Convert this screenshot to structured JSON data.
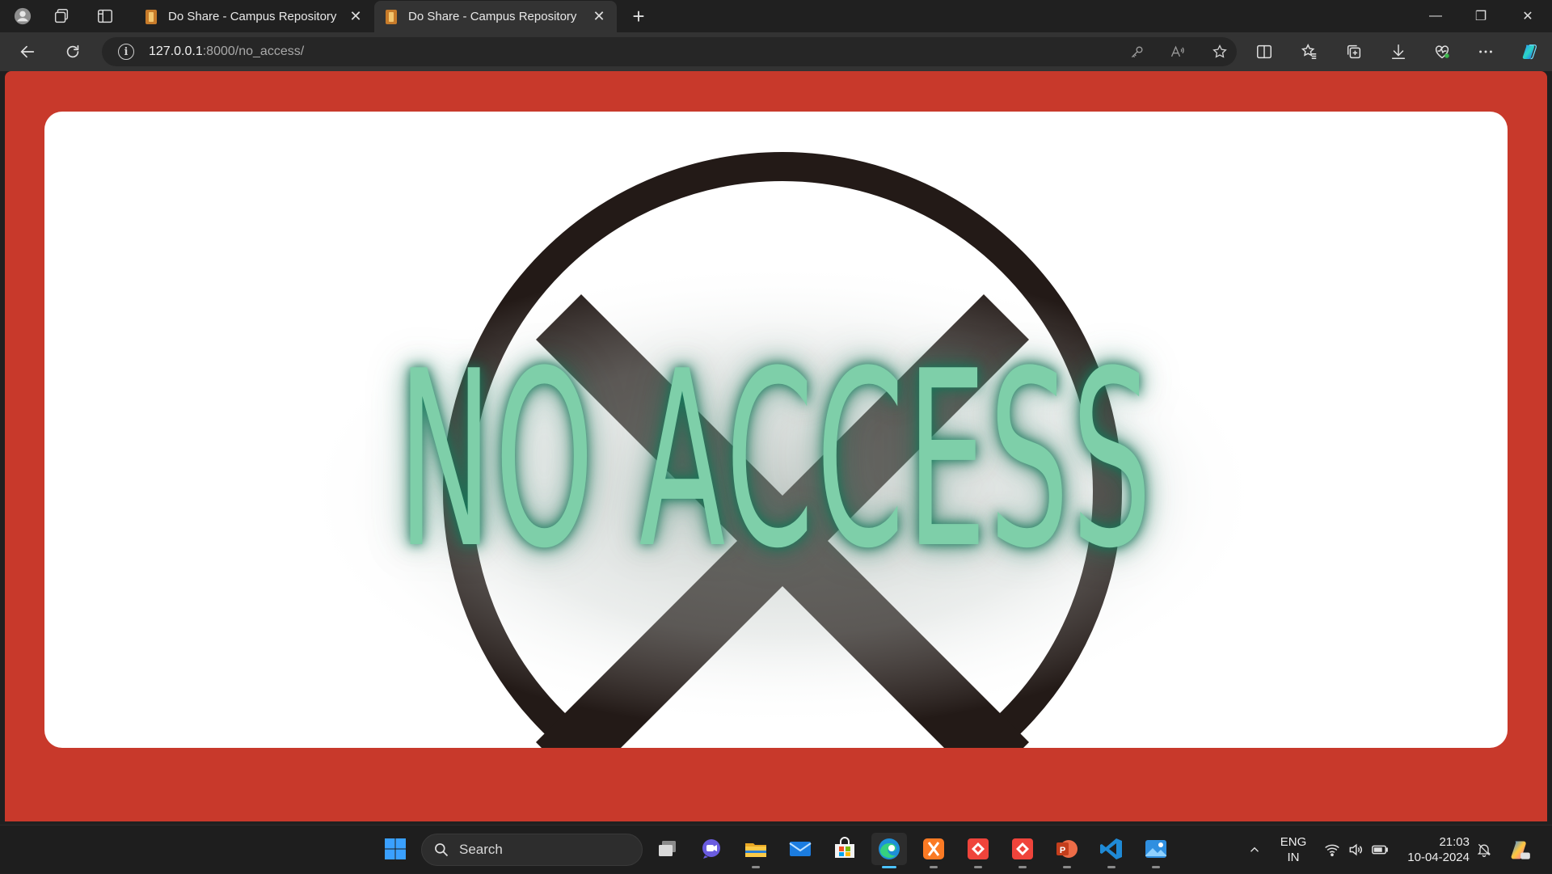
{
  "browser": {
    "tabs": [
      {
        "title": "Do Share - Campus Repository",
        "active": false
      },
      {
        "title": "Do Share - Campus Repository",
        "active": true
      }
    ],
    "new_tab_label": "+",
    "close_glyph": "✕",
    "window_controls": {
      "minimize": "—",
      "restore": "❐",
      "close": "✕"
    },
    "address": {
      "host": "127.0.0.1",
      "rest": ":8000/no_access/"
    }
  },
  "page": {
    "background_color": "#c8392b",
    "banner_text": "NO ACCESS",
    "banner_text_color": "#7ecfa9",
    "symbol": "circle-x-icon"
  },
  "taskbar": {
    "search_placeholder": "Search",
    "apps": [
      "task-view",
      "meet",
      "file-explorer",
      "mail",
      "microsoft-store",
      "edge",
      "xampp",
      "anydesk",
      "anydesk",
      "powerpoint",
      "vscode",
      "photos"
    ],
    "tray": {
      "lang_line1": "ENG",
      "lang_line2": "IN",
      "time": "21:03",
      "date": "10-04-2024"
    }
  }
}
